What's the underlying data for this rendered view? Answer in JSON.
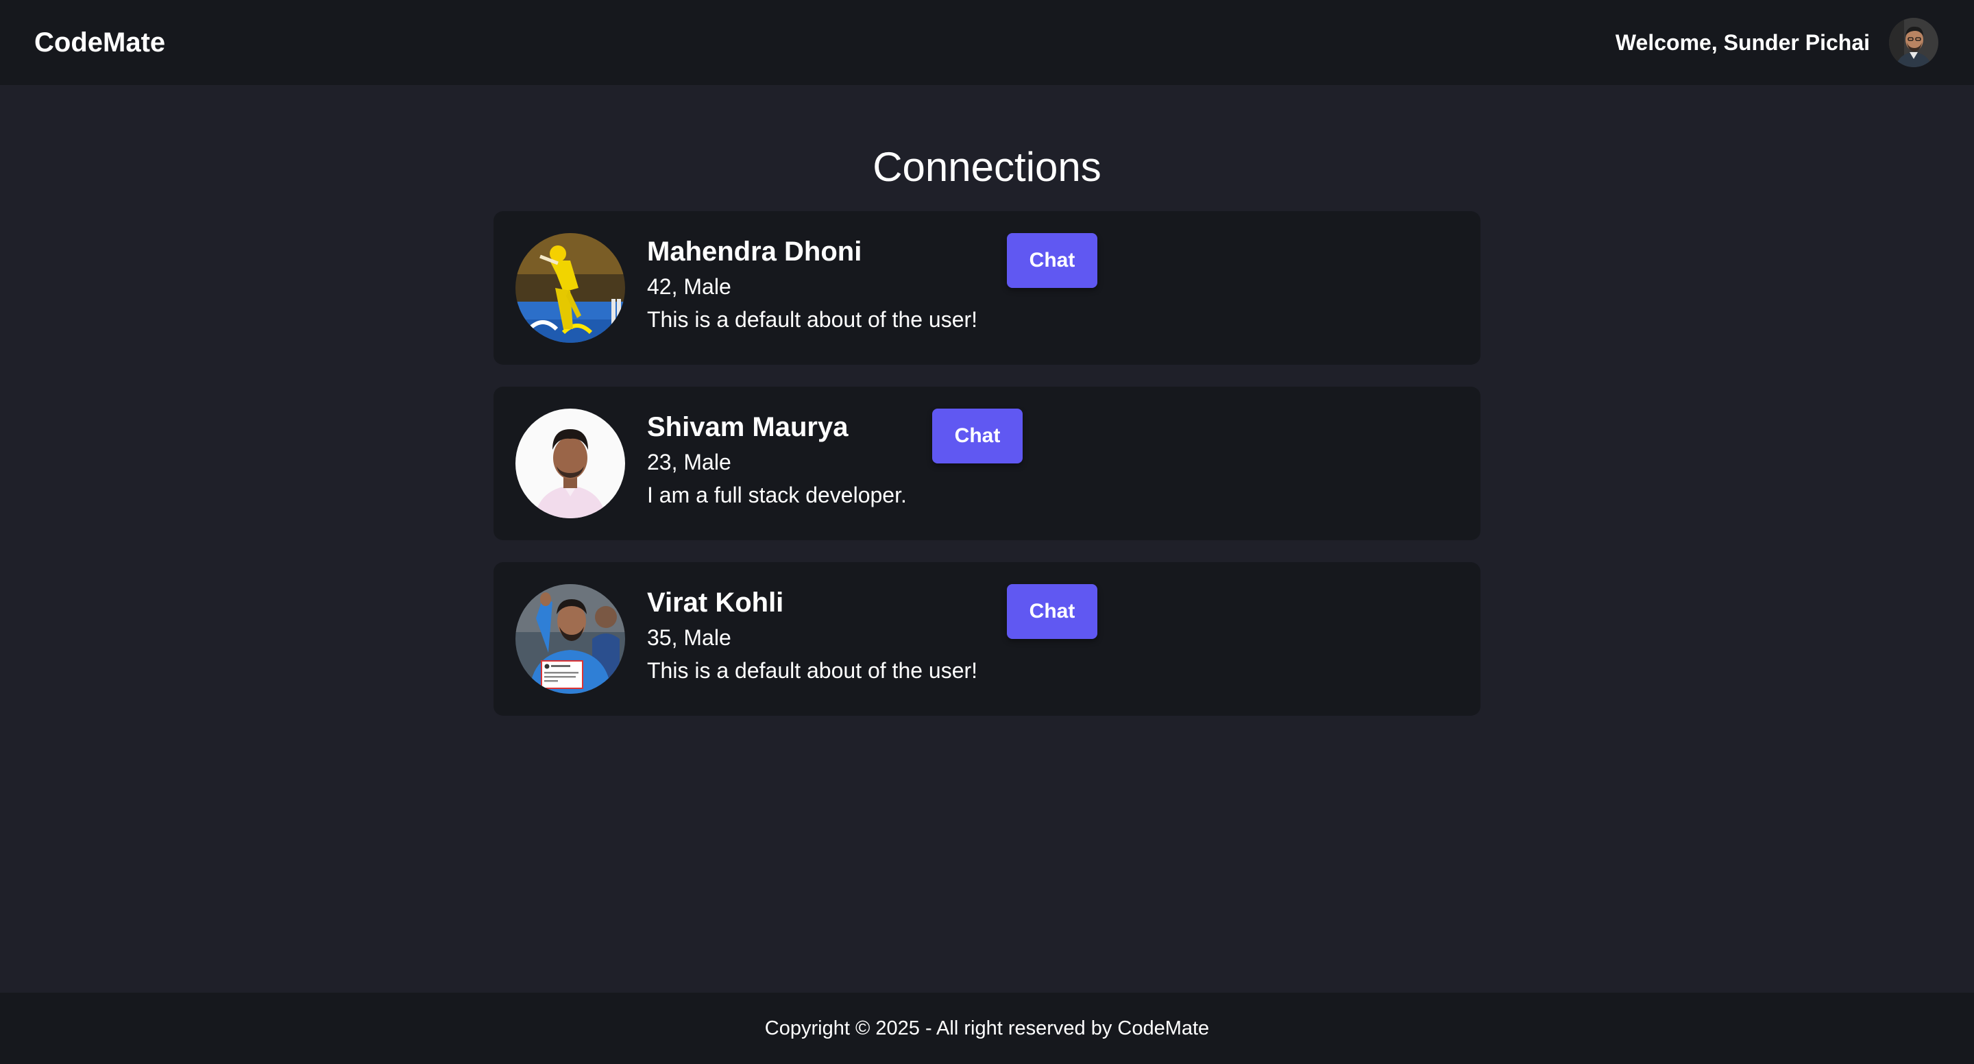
{
  "navbar": {
    "brand": "CodeMate",
    "welcome": "Welcome, Sunder Pichai",
    "avatar_icon": "user-avatar"
  },
  "main": {
    "title": "Connections",
    "connections": [
      {
        "name": "Mahendra Dhoni",
        "meta": "42, Male",
        "about": "This is a default about of the user!",
        "chat_label": "Chat"
      },
      {
        "name": "Shivam Maurya",
        "meta": "23, Male",
        "about": "I am a full stack developer.",
        "chat_label": "Chat"
      },
      {
        "name": "Virat Kohli",
        "meta": "35, Male",
        "about": "This is a default about of the user!",
        "chat_label": "Chat"
      }
    ]
  },
  "footer": {
    "copyright": "Copyright © 2025 - All right reserved by CodeMate"
  },
  "colors": {
    "page_bg": "#1f2029",
    "bar_bg": "#16181d",
    "card_bg": "#16181d",
    "accent": "#6058f2",
    "text": "#ffffff"
  }
}
